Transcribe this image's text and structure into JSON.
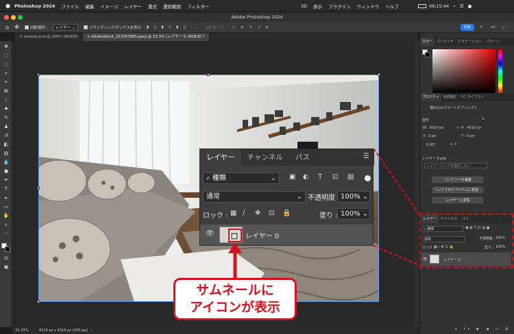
{
  "menubar": {
    "app": "Photoshop 2024",
    "items": [
      "ファイル",
      "編集",
      "イメージ",
      "レイヤー",
      "書式",
      "選択範囲",
      "フィルター"
    ],
    "right_items": [
      "3D",
      "表示",
      "プラグイン",
      "ウィンドウ",
      "ヘルプ"
    ],
    "time": "06:15:44"
  },
  "window": {
    "title": "Adobe Photoshop 2024"
  },
  "options": {
    "auto_select": "自動選択 :",
    "target": "レイヤー",
    "bounding": "バウンディングボックスを表示",
    "mode3d": "3D モード :",
    "share": "共有"
  },
  "tabs": [
    {
      "label": "sample.psd @ 300% (RGB/8)",
      "active": false
    },
    {
      "label": "AdobeStock_253367885.jpeg @ 33.3% (レイヤー 0, RGB/8) *",
      "active": true
    }
  ],
  "status": {
    "zoom": "33.33%",
    "info": "6016 px x 4016 px (300 ppi)"
  },
  "color_panel": {
    "tabs": [
      "カラー",
      "スウォッチ",
      "グラデーション",
      "パターン"
    ]
  },
  "properties": {
    "tabs": [
      "プロパティ",
      "色調補正",
      "CC ライブラリ"
    ],
    "kind": "埋め込みスマートオブジェクト",
    "transform": "変形",
    "w": "W : 6016 px",
    "h": "H : 4016 px",
    "x": "X : 0 px",
    "y": "Y : 0 px",
    "angle": "0.00°",
    "file": "レイヤー 0.psb",
    "comp": "レイヤーカンプを選択しない",
    "btn_edit": "コンテンツを編集",
    "btn_convert": "リンクされたアイテムに変換...",
    "btn_layer": "レイヤーに変換"
  },
  "small_layers": {
    "tabs": [
      "レイヤー",
      "チャンネル",
      "パス"
    ],
    "kind": "種類",
    "blend": "通常",
    "opacity_label": "不透明度 :",
    "opacity": "100%",
    "lock": "ロック :",
    "fill_label": "塗り :",
    "fill": "100%",
    "layer_name": "レイヤー 0"
  },
  "big_layers": {
    "tabs": [
      "レイヤー",
      "チャンネル",
      "パス"
    ],
    "kind": "種類",
    "blend": "通常",
    "opacity_label": "不透明度 :",
    "opacity": "100%",
    "lock": "ロック :",
    "fill_label": "塗り :",
    "fill": "100%",
    "layer_name": "レイヤー 0"
  },
  "callout": {
    "line1": "サムネールに",
    "line2": "アイコンが表示"
  },
  "colors": {
    "accent": "#d8101c",
    "share": "#2c7be5"
  }
}
